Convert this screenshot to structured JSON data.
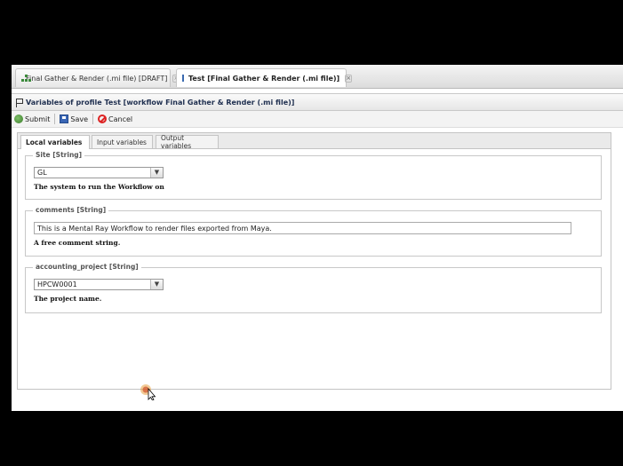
{
  "tabs": [
    {
      "label": "Final Gather & Render (.mi file) [DRAFT]",
      "icon": "workflow-tree-icon",
      "close": "×"
    },
    {
      "label": "Test [Final Gather & Render (.mi file)]",
      "icon": "window-icon",
      "close": "×"
    }
  ],
  "panel": {
    "title": "Variables of profile Test [workflow Final Gather & Render (.mi file)]"
  },
  "toolbar": {
    "submit_label": "Submit",
    "save_label": "Save",
    "cancel_label": "Cancel"
  },
  "subtabs": [
    {
      "label": "Local variables"
    },
    {
      "label": "Input variables"
    },
    {
      "label": "Output variables"
    }
  ],
  "variables": {
    "site": {
      "legend": "Site [String]",
      "value": "GL",
      "description": "The system to run the Workflow on"
    },
    "comments": {
      "legend": "comments [String]",
      "value": "This is a Mental Ray Workflow to render files exported from Maya.",
      "description": "A free comment string."
    },
    "accounting": {
      "legend": "accounting_project [String]",
      "value": "HPCW0001",
      "description": "The project name."
    }
  },
  "colors": {
    "submit": "#3a7d2a",
    "save": "#3a66b5",
    "cancel": "#dd2222",
    "header_text": "#203050"
  }
}
